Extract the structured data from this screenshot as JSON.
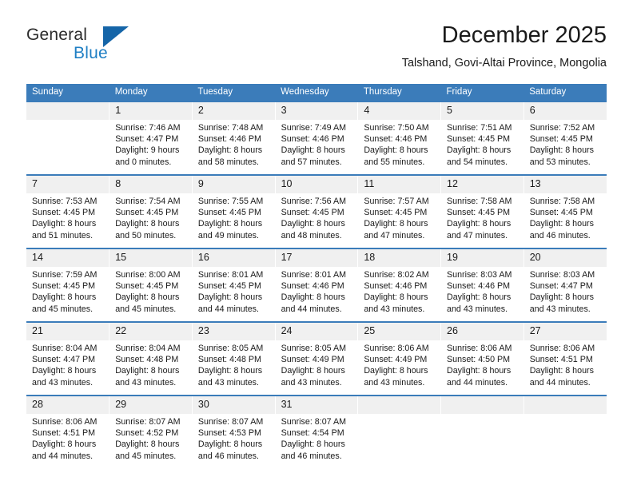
{
  "logo": {
    "word_one": "General",
    "word_two": "Blue",
    "triangle_icon": "blue-triangle-icon",
    "accent_color": "#1565a8"
  },
  "header": {
    "title": "December 2025",
    "subtitle": "Talshand, Govi-Altai Province, Mongolia"
  },
  "calendar": {
    "header_color": "#3b7cba",
    "daynum_background": "#f0f0f0",
    "weekday_headers": [
      "Sunday",
      "Monday",
      "Tuesday",
      "Wednesday",
      "Thursday",
      "Friday",
      "Saturday"
    ],
    "weeks": [
      [
        {
          "day": "",
          "lines": [
            "",
            "",
            "",
            ""
          ]
        },
        {
          "day": "1",
          "lines": [
            "Sunrise: 7:46 AM",
            "Sunset: 4:47 PM",
            "Daylight: 9 hours",
            "and 0 minutes."
          ]
        },
        {
          "day": "2",
          "lines": [
            "Sunrise: 7:48 AM",
            "Sunset: 4:46 PM",
            "Daylight: 8 hours",
            "and 58 minutes."
          ]
        },
        {
          "day": "3",
          "lines": [
            "Sunrise: 7:49 AM",
            "Sunset: 4:46 PM",
            "Daylight: 8 hours",
            "and 57 minutes."
          ]
        },
        {
          "day": "4",
          "lines": [
            "Sunrise: 7:50 AM",
            "Sunset: 4:46 PM",
            "Daylight: 8 hours",
            "and 55 minutes."
          ]
        },
        {
          "day": "5",
          "lines": [
            "Sunrise: 7:51 AM",
            "Sunset: 4:45 PM",
            "Daylight: 8 hours",
            "and 54 minutes."
          ]
        },
        {
          "day": "6",
          "lines": [
            "Sunrise: 7:52 AM",
            "Sunset: 4:45 PM",
            "Daylight: 8 hours",
            "and 53 minutes."
          ]
        }
      ],
      [
        {
          "day": "7",
          "lines": [
            "Sunrise: 7:53 AM",
            "Sunset: 4:45 PM",
            "Daylight: 8 hours",
            "and 51 minutes."
          ]
        },
        {
          "day": "8",
          "lines": [
            "Sunrise: 7:54 AM",
            "Sunset: 4:45 PM",
            "Daylight: 8 hours",
            "and 50 minutes."
          ]
        },
        {
          "day": "9",
          "lines": [
            "Sunrise: 7:55 AM",
            "Sunset: 4:45 PM",
            "Daylight: 8 hours",
            "and 49 minutes."
          ]
        },
        {
          "day": "10",
          "lines": [
            "Sunrise: 7:56 AM",
            "Sunset: 4:45 PM",
            "Daylight: 8 hours",
            "and 48 minutes."
          ]
        },
        {
          "day": "11",
          "lines": [
            "Sunrise: 7:57 AM",
            "Sunset: 4:45 PM",
            "Daylight: 8 hours",
            "and 47 minutes."
          ]
        },
        {
          "day": "12",
          "lines": [
            "Sunrise: 7:58 AM",
            "Sunset: 4:45 PM",
            "Daylight: 8 hours",
            "and 47 minutes."
          ]
        },
        {
          "day": "13",
          "lines": [
            "Sunrise: 7:58 AM",
            "Sunset: 4:45 PM",
            "Daylight: 8 hours",
            "and 46 minutes."
          ]
        }
      ],
      [
        {
          "day": "14",
          "lines": [
            "Sunrise: 7:59 AM",
            "Sunset: 4:45 PM",
            "Daylight: 8 hours",
            "and 45 minutes."
          ]
        },
        {
          "day": "15",
          "lines": [
            "Sunrise: 8:00 AM",
            "Sunset: 4:45 PM",
            "Daylight: 8 hours",
            "and 45 minutes."
          ]
        },
        {
          "day": "16",
          "lines": [
            "Sunrise: 8:01 AM",
            "Sunset: 4:45 PM",
            "Daylight: 8 hours",
            "and 44 minutes."
          ]
        },
        {
          "day": "17",
          "lines": [
            "Sunrise: 8:01 AM",
            "Sunset: 4:46 PM",
            "Daylight: 8 hours",
            "and 44 minutes."
          ]
        },
        {
          "day": "18",
          "lines": [
            "Sunrise: 8:02 AM",
            "Sunset: 4:46 PM",
            "Daylight: 8 hours",
            "and 43 minutes."
          ]
        },
        {
          "day": "19",
          "lines": [
            "Sunrise: 8:03 AM",
            "Sunset: 4:46 PM",
            "Daylight: 8 hours",
            "and 43 minutes."
          ]
        },
        {
          "day": "20",
          "lines": [
            "Sunrise: 8:03 AM",
            "Sunset: 4:47 PM",
            "Daylight: 8 hours",
            "and 43 minutes."
          ]
        }
      ],
      [
        {
          "day": "21",
          "lines": [
            "Sunrise: 8:04 AM",
            "Sunset: 4:47 PM",
            "Daylight: 8 hours",
            "and 43 minutes."
          ]
        },
        {
          "day": "22",
          "lines": [
            "Sunrise: 8:04 AM",
            "Sunset: 4:48 PM",
            "Daylight: 8 hours",
            "and 43 minutes."
          ]
        },
        {
          "day": "23",
          "lines": [
            "Sunrise: 8:05 AM",
            "Sunset: 4:48 PM",
            "Daylight: 8 hours",
            "and 43 minutes."
          ]
        },
        {
          "day": "24",
          "lines": [
            "Sunrise: 8:05 AM",
            "Sunset: 4:49 PM",
            "Daylight: 8 hours",
            "and 43 minutes."
          ]
        },
        {
          "day": "25",
          "lines": [
            "Sunrise: 8:06 AM",
            "Sunset: 4:49 PM",
            "Daylight: 8 hours",
            "and 43 minutes."
          ]
        },
        {
          "day": "26",
          "lines": [
            "Sunrise: 8:06 AM",
            "Sunset: 4:50 PM",
            "Daylight: 8 hours",
            "and 44 minutes."
          ]
        },
        {
          "day": "27",
          "lines": [
            "Sunrise: 8:06 AM",
            "Sunset: 4:51 PM",
            "Daylight: 8 hours",
            "and 44 minutes."
          ]
        }
      ],
      [
        {
          "day": "28",
          "lines": [
            "Sunrise: 8:06 AM",
            "Sunset: 4:51 PM",
            "Daylight: 8 hours",
            "and 44 minutes."
          ]
        },
        {
          "day": "29",
          "lines": [
            "Sunrise: 8:07 AM",
            "Sunset: 4:52 PM",
            "Daylight: 8 hours",
            "and 45 minutes."
          ]
        },
        {
          "day": "30",
          "lines": [
            "Sunrise: 8:07 AM",
            "Sunset: 4:53 PM",
            "Daylight: 8 hours",
            "and 46 minutes."
          ]
        },
        {
          "day": "31",
          "lines": [
            "Sunrise: 8:07 AM",
            "Sunset: 4:54 PM",
            "Daylight: 8 hours",
            "and 46 minutes."
          ]
        },
        {
          "day": "",
          "lines": [
            "",
            "",
            "",
            ""
          ]
        },
        {
          "day": "",
          "lines": [
            "",
            "",
            "",
            ""
          ]
        },
        {
          "day": "",
          "lines": [
            "",
            "",
            "",
            ""
          ]
        }
      ]
    ]
  }
}
